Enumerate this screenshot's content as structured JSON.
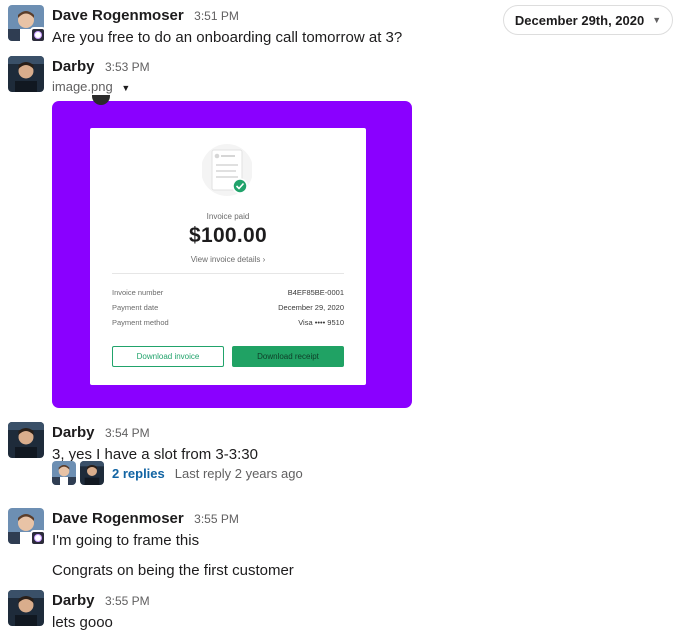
{
  "date_divider": {
    "label": "December 29th, 2020"
  },
  "messages": [
    {
      "author": "Dave Rogenmoser",
      "time": "3:51 PM",
      "text": "Are you free to do an onboarding call tomorrow at 3?"
    },
    {
      "author": "Darby",
      "time": "3:53 PM",
      "file_name": "image.png",
      "invoice": {
        "status": "Invoice paid",
        "amount": "$100.00",
        "details_link": "View invoice details",
        "rows": [
          {
            "label": "Invoice number",
            "value": "B4EF85BE-0001"
          },
          {
            "label": "Payment date",
            "value": "December 29, 2020"
          },
          {
            "label": "Payment method",
            "value": "Visa •••• 9510"
          }
        ],
        "download_invoice": "Download invoice",
        "download_receipt": "Download receipt"
      }
    },
    {
      "author": "Darby",
      "time": "3:54 PM",
      "text": "3, yes I have a slot from 3-3:30",
      "thread": {
        "replies": "2 replies",
        "last_reply": "Last reply 2 years ago"
      }
    },
    {
      "author": "Dave Rogenmoser",
      "time": "3:55 PM",
      "text": "I'm going to frame this",
      "text2": "Congrats on being the first customer"
    },
    {
      "author": "Darby",
      "time": "3:55 PM",
      "text": "lets gooo"
    }
  ],
  "icons": {
    "date_chevron": "chevron-down-icon",
    "file_caret": "caret-down-icon",
    "invoice_document": "document-check-icon",
    "details_arrow": "chevron-right-icon"
  },
  "colors": {
    "link": "#1264a3",
    "attachment_bg": "#8a00ff",
    "invoice_green": "#20a264"
  }
}
